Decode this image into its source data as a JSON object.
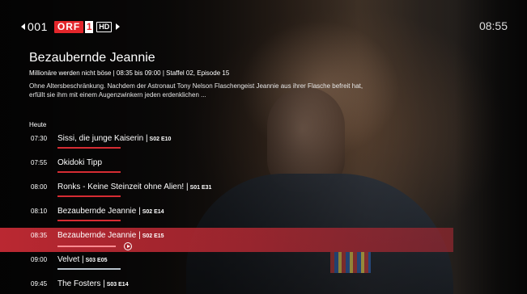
{
  "header": {
    "channel_number": "001",
    "channel_logo": "ORF",
    "channel_logo_digit": "1",
    "quality_badge": "HD",
    "clock": "08:55"
  },
  "program": {
    "title": "Bezaubernde Jeannie",
    "meta": "Millionäre werden nicht böse  |  08:35 bis 09:00  |  Staffel 02, Episode 15",
    "description": "Ohne Altersbeschränkung. Nachdem der Astronaut Tony Nelson Flaschengeist Jeannie aus ihrer Flasche befreit hat, erfüllt sie ihm mit einem Augenzwinkern jeden erdenklichen ..."
  },
  "schedule": {
    "day_label": "Heute",
    "items": [
      {
        "time": "07:30",
        "title": "Sissi, die junge Kaiserin |",
        "episode": "S02 E10"
      },
      {
        "time": "07:55",
        "title": "Okidoki Tipp",
        "episode": ""
      },
      {
        "time": "08:00",
        "title": "Ronks - Keine Steinzeit ohne Alien! |",
        "episode": "S01 E31"
      },
      {
        "time": "08:10",
        "title": "Bezaubernde Jeannie |",
        "episode": "S02 E14"
      },
      {
        "time": "08:35",
        "title": "Bezaubernde Jeannie |",
        "episode": "S02 E15"
      },
      {
        "time": "09:00",
        "title": "Velvet |",
        "episode": "S03 E05"
      },
      {
        "time": "09:45",
        "title": "The Fosters |",
        "episode": "S03 E14"
      }
    ]
  },
  "colors": {
    "accent": "#d62c33",
    "selected_row": "#c42a34",
    "orf_red": "#e3262b"
  }
}
